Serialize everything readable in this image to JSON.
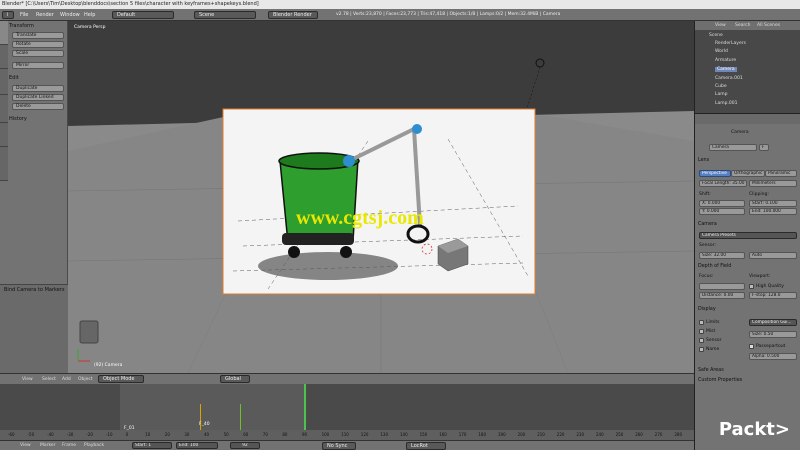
{
  "window": {
    "title": "Blender* [C:\\Users\\Tim\\Desktop\\blenddocs\\section 5 files\\character with keyframes+shapekeys.blend]"
  },
  "topbar": {
    "menus": [
      "File",
      "Render",
      "Window",
      "Help"
    ],
    "layout": "Default",
    "scene": "Scene",
    "engine": "Blender Render",
    "stats": "v2.78 | Verts:23,870 | Faces:23,773 | Tris:47,418 | Objects:1/8 | Lamps:0/2 | Mem:32.4MiB | Camera"
  },
  "toolshelf": {
    "transform_header": "Transform",
    "transform_buttons": [
      "Translate",
      "Rotate",
      "Scale",
      "Mirror"
    ],
    "edit_header": "Edit",
    "edit_buttons": [
      "Duplicate",
      "Duplicate Linked",
      "Delete"
    ],
    "history_header": "History",
    "tabs": [
      "Tools",
      "Create",
      "Relations",
      "Animation",
      "Physics",
      "Grease Pencil"
    ]
  },
  "redo": {
    "label": "Bind Camera to Markers"
  },
  "viewport": {
    "label": "Camera Persp",
    "object_label": "(92) Camera",
    "watermark": "www.cgtsj.com"
  },
  "view_toolbar": {
    "items": [
      "View",
      "Select",
      "Add",
      "Object"
    ],
    "mode": "Object Mode",
    "orientation": "Global"
  },
  "timeline": {
    "ruler": [
      "-60",
      "-50",
      "-40",
      "-30",
      "-20",
      "-10",
      "0",
      "10",
      "20",
      "30",
      "40",
      "50",
      "60",
      "70",
      "80",
      "90",
      "100",
      "110",
      "120",
      "130",
      "140",
      "150",
      "160",
      "170",
      "180",
      "190",
      "200",
      "210",
      "220",
      "230",
      "240",
      "250",
      "260",
      "270",
      "280"
    ],
    "marker_left": "F_01",
    "marker_right": "F_40",
    "menus": [
      "View",
      "Marker",
      "Frame",
      "Playback"
    ],
    "start_label": "Start:",
    "start_value": "1",
    "end_label": "End:",
    "end_value": "100",
    "current": "92",
    "sync": "No Sync",
    "keying": "LocRot"
  },
  "outliner": {
    "tabs": [
      "View",
      "Search",
      "All Scenes"
    ],
    "items": [
      "Scene",
      "RenderLayers",
      "World",
      "Armature",
      "Camera",
      "Camera.001",
      "Cube",
      "Lamp",
      "Lamp.001"
    ]
  },
  "props": {
    "breadcrumb": "Camera",
    "datablock": "Camera",
    "datablock_users": "F",
    "lens_header": "Lens",
    "lens_types": [
      "Perspective",
      "Orthographic",
      "Panoramic"
    ],
    "focal_label": "Focal Length:",
    "focal_value": "35.00",
    "lens_unit": "Millimeters",
    "shift_label": "Shift:",
    "shift_x": "X:",
    "shift_x_val": "0.000",
    "shift_y": "Y:",
    "shift_y_val": "0.000",
    "clipping_label": "Clipping:",
    "clip_start": "Start:",
    "clip_start_val": "0.100",
    "clip_end": "End:",
    "clip_end_val": "100.000",
    "camera_header": "Camera",
    "presets": "Camera Presets",
    "sensor_label": "Sensor:",
    "size_label": "Size:",
    "size_val": "32.00",
    "sensor_fit": "Auto",
    "dof_header": "Depth of Field",
    "focus_label": "Focus:",
    "viewport_label": "Viewport:",
    "distance_label": "Distance:",
    "distance_val": "0.00",
    "high_quality": "High Quality",
    "fstop_label": "F-stop:",
    "fstop_val": "128.0",
    "display_header": "Display",
    "display_checks": [
      "Limits",
      "Mist",
      "Sensor",
      "Name"
    ],
    "composition": "Composition Gui...",
    "disp_size_label": "Size:",
    "disp_size_val": "0.50",
    "passepartout": "Passepartout",
    "alpha_label": "Alpha:",
    "alpha_val": "0.500",
    "safe_areas": "Safe Areas",
    "custom_props": "Custom Properties"
  },
  "brand": {
    "name": "Packt>"
  }
}
